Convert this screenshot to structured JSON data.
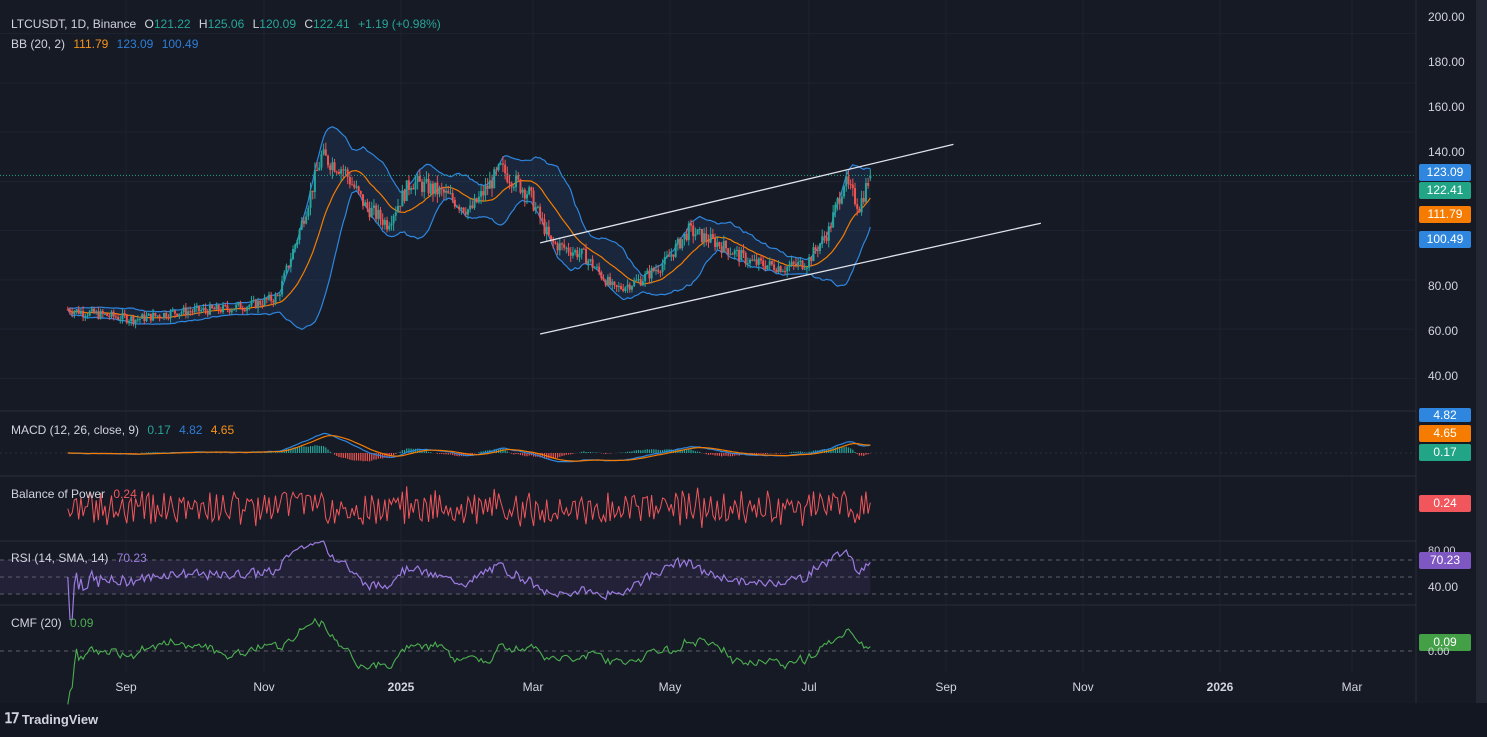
{
  "header": {
    "symbol": "LTCUSDT, 1D, Binance",
    "open_label": "O",
    "open": "121.22",
    "high_label": "H",
    "high": "125.06",
    "low_label": "L",
    "low": "120.09",
    "close_label": "C",
    "close": "122.41",
    "change": "+1.19 (+0.98%)"
  },
  "indicators": {
    "bb": {
      "label": "BB (20, 2)",
      "basis": "111.79",
      "upper": "123.09",
      "lower": "100.49"
    },
    "macd": {
      "label": "MACD (12, 26, close, 9)",
      "hist": "0.17",
      "macd": "4.82",
      "signal": "4.65"
    },
    "bop": {
      "label": "Balance of Power",
      "value": "0.24"
    },
    "rsi": {
      "label": "RSI (14, SMA, 14)",
      "value": "70.23"
    },
    "cmf": {
      "label": "CMF (20)",
      "value": "0.09"
    }
  },
  "price_axis": [
    "200.00",
    "180.00",
    "160.00",
    "140.00",
    "80.00",
    "60.00",
    "40.00"
  ],
  "price_tags": [
    {
      "value": "123.09",
      "color": "#2e86de"
    },
    {
      "value": "122.41",
      "color": "#22a586"
    },
    {
      "value": "111.79",
      "color": "#f57c00"
    },
    {
      "value": "100.49",
      "color": "#2e86de"
    }
  ],
  "macd_tags": [
    "4.82",
    "4.65",
    "0.17"
  ],
  "rsi_axis": [
    "80.00",
    "40.00"
  ],
  "cmf_axis": [
    "0.00"
  ],
  "time_axis": [
    {
      "label": "Sep",
      "bold": false
    },
    {
      "label": "Nov",
      "bold": false
    },
    {
      "label": "2025",
      "bold": true
    },
    {
      "label": "Mar",
      "bold": false
    },
    {
      "label": "May",
      "bold": false
    },
    {
      "label": "Jul",
      "bold": false
    },
    {
      "label": "Sep",
      "bold": false
    },
    {
      "label": "Nov",
      "bold": false
    },
    {
      "label": "2026",
      "bold": true
    },
    {
      "label": "Mar",
      "bold": false
    }
  ],
  "brand": "TradingView",
  "colors": {
    "bg": "#161a25",
    "up": "#26a69a",
    "down": "#ef5350",
    "bb": "#2e86de",
    "basis": "#f57c00",
    "rsi": "#9c7ce0",
    "cmf": "#4caf50",
    "bop": "#f0565b"
  },
  "chart_data": {
    "type": "candlestick",
    "price_ylim": [
      30,
      205
    ],
    "close_path": [
      {
        "date": "2024-08-01",
        "close": 68
      },
      {
        "date": "2024-08-15",
        "close": 66
      },
      {
        "date": "2024-09-01",
        "close": 64
      },
      {
        "date": "2024-09-20",
        "close": 67
      },
      {
        "date": "2024-10-10",
        "close": 68
      },
      {
        "date": "2024-10-25",
        "close": 70
      },
      {
        "date": "2024-11-05",
        "close": 73
      },
      {
        "date": "2024-11-15",
        "close": 100
      },
      {
        "date": "2024-11-25",
        "close": 130
      },
      {
        "date": "2024-12-05",
        "close": 125
      },
      {
        "date": "2024-12-15",
        "close": 110
      },
      {
        "date": "2024-12-25",
        "close": 103
      },
      {
        "date": "2025-01-05",
        "close": 120
      },
      {
        "date": "2025-01-20",
        "close": 115
      },
      {
        "date": "2025-02-01",
        "close": 108
      },
      {
        "date": "2025-02-15",
        "close": 125
      },
      {
        "date": "2025-02-28",
        "close": 115
      },
      {
        "date": "2025-03-10",
        "close": 95
      },
      {
        "date": "2025-03-25",
        "close": 90
      },
      {
        "date": "2025-04-08",
        "close": 76
      },
      {
        "date": "2025-04-20",
        "close": 80
      },
      {
        "date": "2025-05-01",
        "close": 87
      },
      {
        "date": "2025-05-12",
        "close": 100
      },
      {
        "date": "2025-05-25",
        "close": 95
      },
      {
        "date": "2025-06-10",
        "close": 87
      },
      {
        "date": "2025-06-25",
        "close": 85
      },
      {
        "date": "2025-07-05",
        "close": 87
      },
      {
        "date": "2025-07-15",
        "close": 100
      },
      {
        "date": "2025-07-22",
        "close": 120
      },
      {
        "date": "2025-07-29",
        "close": 110
      },
      {
        "date": "2025-08-03",
        "close": 122.41
      }
    ],
    "channel": {
      "upper": [
        {
          "date": "2025-03-05",
          "value": 95
        },
        {
          "date": "2025-09-10",
          "value": 135
        }
      ],
      "lower": [
        {
          "date": "2025-03-05",
          "value": 58
        },
        {
          "date": "2025-10-20",
          "value": 103
        }
      ]
    }
  }
}
